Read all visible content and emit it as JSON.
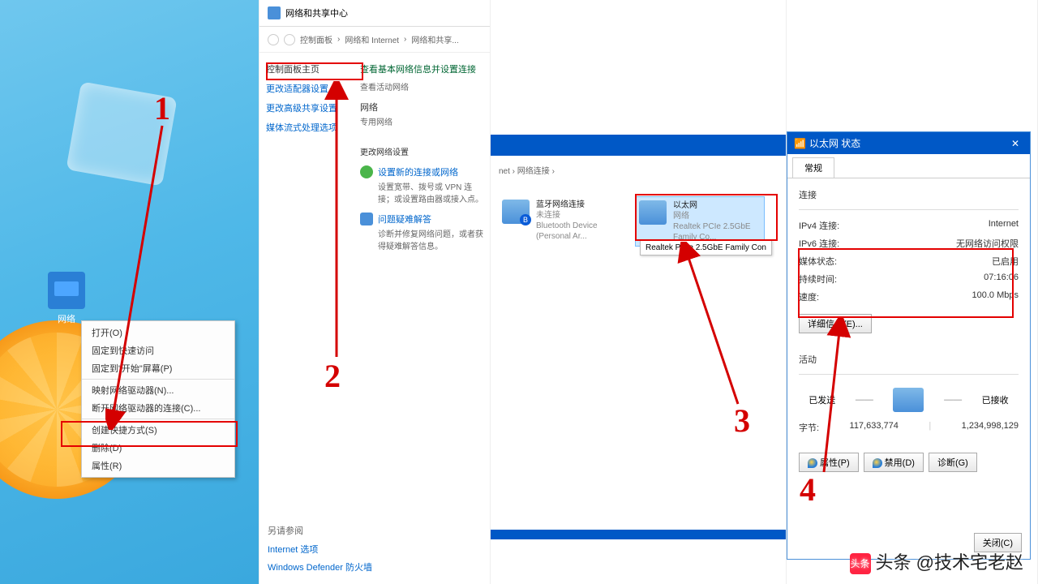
{
  "watermark": "头条 @技术宅老赵",
  "steps": {
    "s1": "1",
    "s2": "2",
    "s3": "3",
    "s4": "4"
  },
  "panel1": {
    "icon_label": "网络",
    "ctx": {
      "open": "打开(O)",
      "pin_quick": "固定到快速访问",
      "pin_start": "固定到\"开始\"屏幕(P)",
      "map_drive": "映射网络驱动器(N)...",
      "disconnect_drive": "断开网络驱动器的连接(C)...",
      "shortcut": "创建快捷方式(S)",
      "delete": "删除(D)",
      "properties": "属性(R)"
    }
  },
  "panel2": {
    "title": "网络和共享中心",
    "crumb1": "控制面板",
    "crumb2": "网络和 Internet",
    "crumb3": "网络和共享...",
    "left_header": "控制面板主页",
    "link_adapter": "更改适配器设置",
    "link_sharing": "更改高级共享设置",
    "link_media": "媒体流式处理选项",
    "right_header": "查看基本网络信息并设置连接",
    "view_active": "查看活动网络",
    "net_name": "网络",
    "net_priv": "专用网络",
    "change_net_header": "更改网络设置",
    "setup_new": "设置新的连接或网络",
    "setup_desc": "设置宽带、拨号或 VPN 连接；或设置路由器或接入点。",
    "troubleshoot": "问题疑难解答",
    "troubleshoot_desc": "诊断并修复网络问题，或者获得疑难解答信息。",
    "footer_header": "另请参阅",
    "footer1": "Internet 选项",
    "footer2": "Windows Defender 防火墙"
  },
  "panel3": {
    "crumb_net": "net",
    "crumb_conn": "网络连接",
    "bt_title": "蓝牙网络连接",
    "bt_status": "未连接",
    "bt_device": "Bluetooth Device (Personal Ar...",
    "eth_title": "以太网",
    "eth_status": "网络",
    "eth_device": "Realtek PCIe 2.5GbE Family Co...",
    "tooltip": "Realtek PCIe 2.5GbE Family Con"
  },
  "panel4": {
    "title": "以太网 状态",
    "tab": "常规",
    "section_conn": "连接",
    "ipv4_k": "IPv4 连接:",
    "ipv4_v": "Internet",
    "ipv6_k": "IPv6 连接:",
    "ipv6_v": "无网络访问权限",
    "media_k": "媒体状态:",
    "media_v": "已启用",
    "duration_k": "持续时间:",
    "duration_v": "07:16:06",
    "speed_k": "速度:",
    "speed_v": "100.0 Mbps",
    "details_btn": "详细信息(E)...",
    "section_activity": "活动",
    "sent_label": "已发送",
    "recv_label": "已接收",
    "bytes_k": "字节:",
    "bytes_sent": "117,633,774",
    "bytes_recv": "1,234,998,129",
    "btn_props": "属性(P)",
    "btn_disable": "禁用(D)",
    "btn_diag": "诊断(G)",
    "btn_close": "关闭(C)"
  }
}
